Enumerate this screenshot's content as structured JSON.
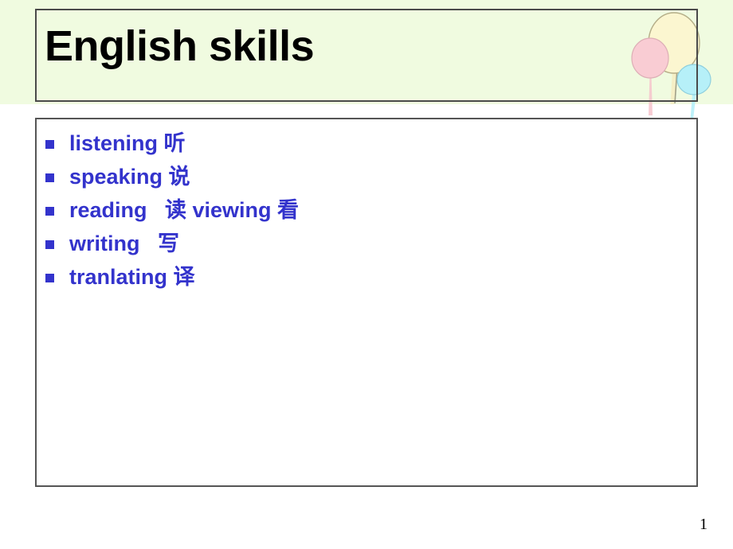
{
  "slide": {
    "background_color": "#ffffff",
    "header_band_color": "#f0fbe0",
    "border_color": "#4a4a4a",
    "accent_color": "#3333cc",
    "title": "English skills",
    "page_number": "1"
  },
  "decoration": {
    "name": "balloons-decoration",
    "balloons": [
      {
        "name": "pink-balloon",
        "color": "#f9ccd3",
        "stroke": "#e9b5bd"
      },
      {
        "name": "yellow-balloon",
        "color": "#fbf6d0",
        "stroke": "#e6dfa8"
      },
      {
        "name": "cyan-balloon",
        "color": "#b6f0f8",
        "stroke": "#8fdfec"
      }
    ]
  },
  "content": {
    "bullets": [
      {
        "label": "listening 听"
      },
      {
        "label": "speaking 说"
      },
      {
        "label": "reading   读 viewing 看"
      },
      {
        "label": "writing   写"
      },
      {
        "label": "tranlating 译"
      }
    ]
  }
}
